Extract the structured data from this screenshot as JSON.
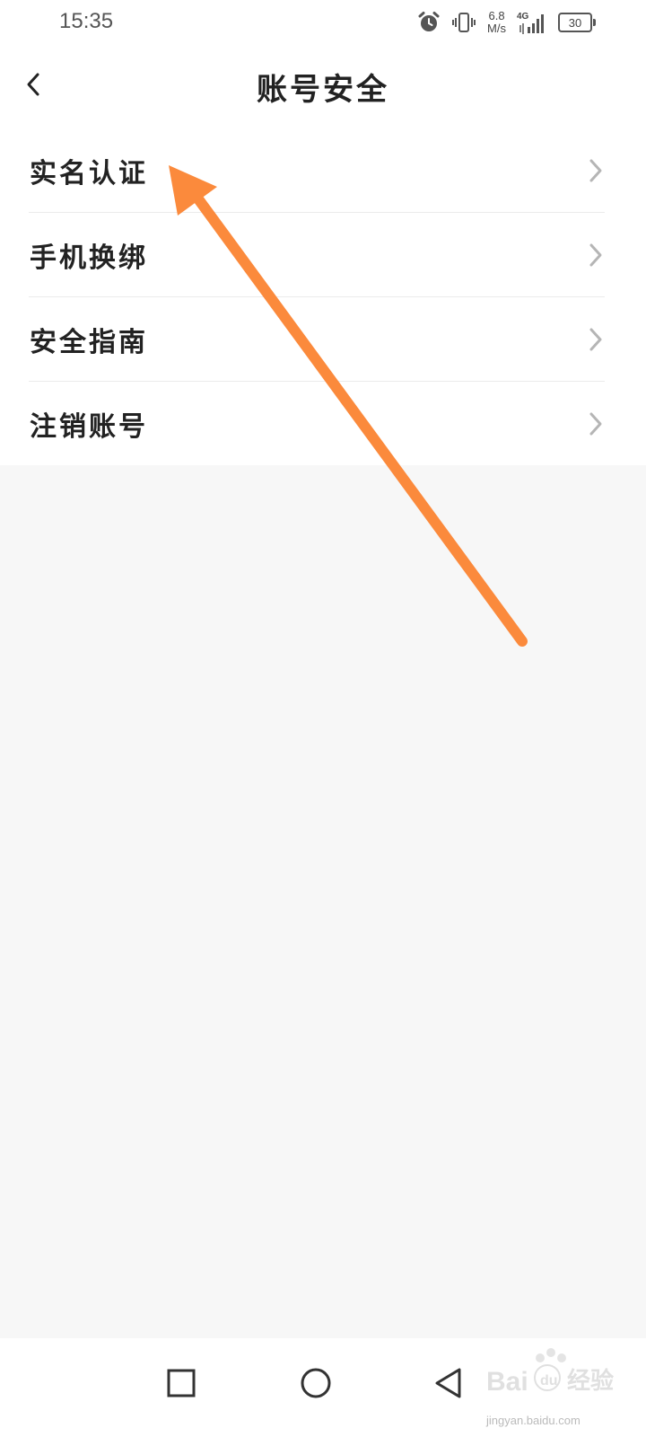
{
  "status_bar": {
    "time": "15:35",
    "network_speed_value": "6.8",
    "network_speed_unit": "M/s",
    "network_type": "4G",
    "battery_level": "30",
    "icons": [
      "alarm-icon",
      "vibrate-icon",
      "signal-icon",
      "battery-icon"
    ]
  },
  "header": {
    "title": "账号安全",
    "back_icon": "chevron-left-icon"
  },
  "menu": {
    "items": [
      {
        "label": "实名认证"
      },
      {
        "label": "手机换绑"
      },
      {
        "label": "安全指南"
      },
      {
        "label": "注销账号"
      }
    ]
  },
  "nav_bar": {
    "icons": [
      "recent-apps-icon",
      "home-icon",
      "back-triangle-icon"
    ]
  },
  "watermark": {
    "text": "Bai度经验",
    "sub_text": "jingyan.baidu.com"
  },
  "colors": {
    "annotation_arrow": "#fb8a3c",
    "page_background": "#f7f7f7",
    "surface": "#ffffff"
  }
}
